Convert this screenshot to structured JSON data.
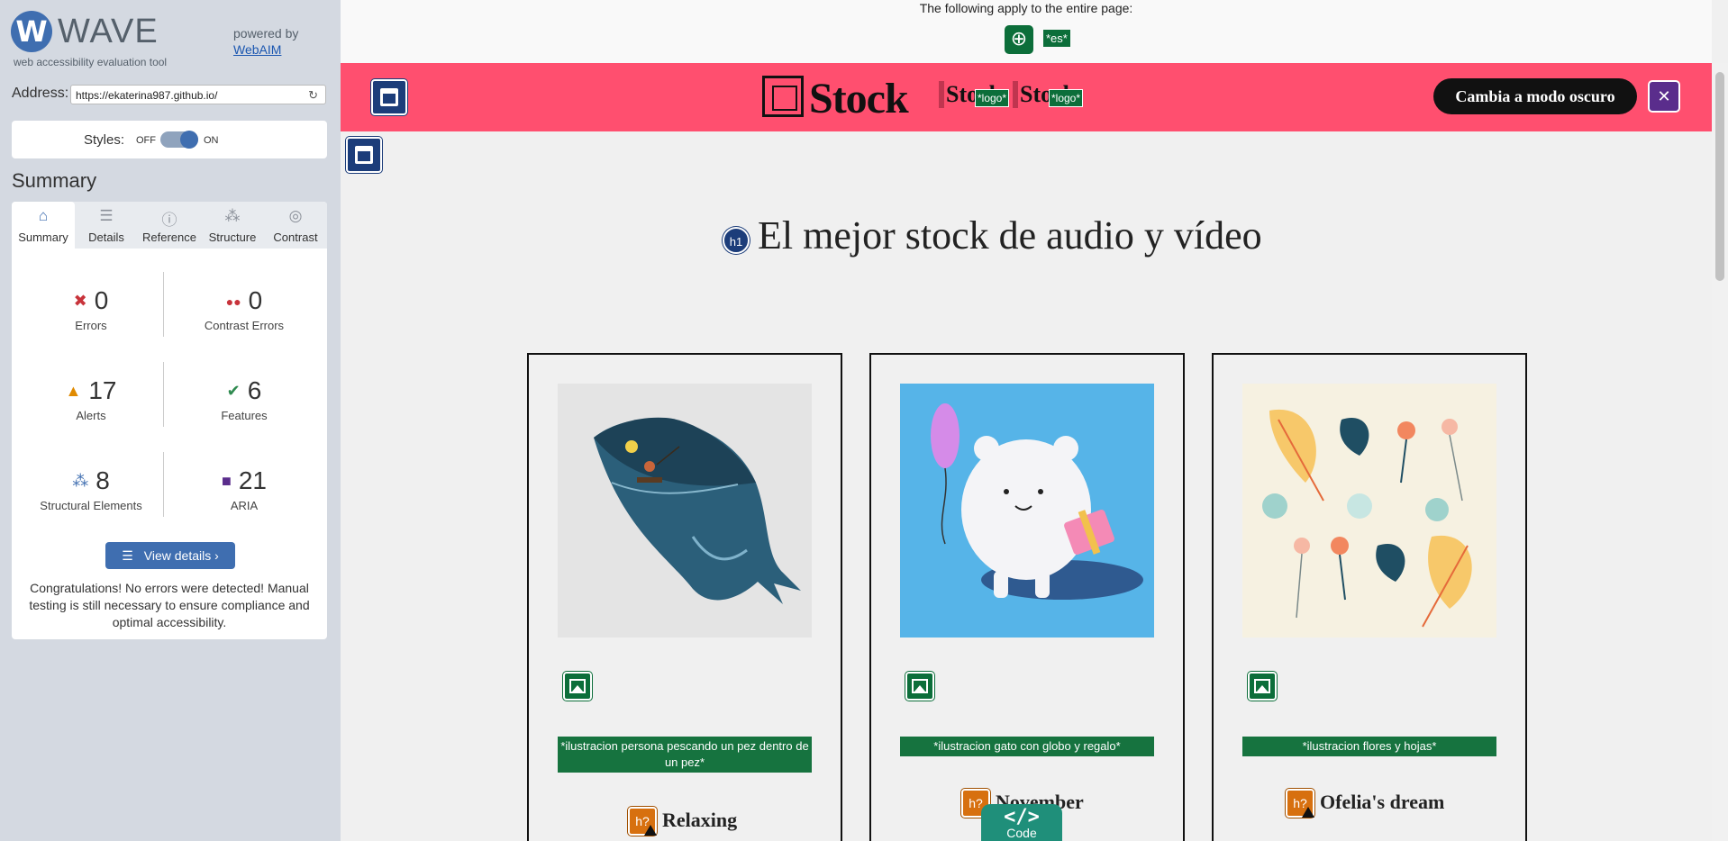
{
  "wave": {
    "logo_letter": "W",
    "brand": "WAVE",
    "tagline": "web accessibility evaluation tool",
    "powered_by": "powered by",
    "webaim_link": "WebAIM",
    "address_label": "Address:",
    "address_value": "https://ekaterina987.github.io/",
    "reload_icon": "↻",
    "styles_label": "Styles:",
    "styles_off": "OFF",
    "styles_on": "ON",
    "summary_heading": "Summary",
    "tabs": [
      {
        "label": "Summary",
        "icon": "⌂"
      },
      {
        "label": "Details",
        "icon": "☰"
      },
      {
        "label": "Reference",
        "icon": "ⓘ"
      },
      {
        "label": "Structure",
        "icon": "⁂"
      },
      {
        "label": "Contrast",
        "icon": "◎"
      }
    ],
    "stats": {
      "errors": {
        "count": "0",
        "label": "Errors",
        "icon": "✖",
        "color": "#c8333b"
      },
      "contrast": {
        "count": "0",
        "label": "Contrast Errors",
        "icon": "●●",
        "color": "#c8333b"
      },
      "alerts": {
        "count": "17",
        "label": "Alerts",
        "icon": "▲",
        "color": "#e08a00"
      },
      "features": {
        "count": "6",
        "label": "Features",
        "icon": "✔",
        "color": "#2f8a4f"
      },
      "structural": {
        "count": "8",
        "label": "Structural Elements",
        "icon": "⁂",
        "color": "#3f6eb0"
      },
      "aria": {
        "count": "21",
        "label": "ARIA",
        "icon": "■",
        "color": "#5a2d8c"
      }
    },
    "view_details": "View details ›",
    "view_icon": "☰",
    "congrats": "Congratulations! No errors were detected! Manual testing is still necessary to ensure compliance and optimal accessibility."
  },
  "page": {
    "applies_text": "The following apply to the entire page:",
    "globe_icon": "⊕",
    "lang_tag": "*es*",
    "logo_text": "Stock",
    "mini_logo_text": "Stock",
    "logo_tag": "*logo*",
    "dark_mode_button": "Cambia a modo oscuro",
    "close_icon": "✕",
    "h1_badge": "h1",
    "heading": "El mejor stock de audio y vídeo",
    "hq_badge": "h?",
    "cards": [
      {
        "alt": "*ilustracion persona pescando un pez dentro de un pez*",
        "title": "Relaxing"
      },
      {
        "alt": "*ilustracion gato con globo y regalo*",
        "title": "November"
      },
      {
        "alt": "*ilustracion flores y hojas*",
        "title": "Ofelia's dream"
      }
    ],
    "code_icon": "</>",
    "code_label": "Code"
  },
  "colors": {
    "header_bg": "#ff4f6f",
    "wave_blue": "#3f6eb0",
    "feature_green": "#0c6e3a",
    "alert_orange": "#d7700f",
    "aria_purple": "#5a2d8c"
  }
}
